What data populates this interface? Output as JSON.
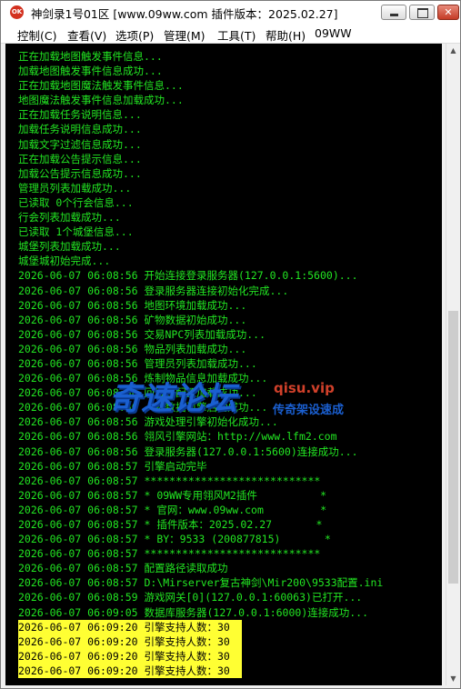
{
  "window": {
    "icon_text": "OK",
    "title": "神剑录1号01区 [www.09ww.com 插件版本：2025.02.27]",
    "controls": {
      "minimize": "",
      "maximize": "",
      "close": "✕"
    }
  },
  "menu": [
    "控制(C)",
    "查看(V)",
    "选项(P)",
    "管理(M)",
    "工具(T)",
    "帮助(H)",
    "09WW"
  ],
  "console": {
    "lines": [
      "正在加载地图触发事件信息...",
      "加载地图触发事件信息成功...",
      "正在加载地图魔法触发事件信息...",
      "地图魔法触发事件信息加载成功...",
      "正在加载任务说明信息...",
      "加载任务说明信息成功...",
      "加载文字过滤信息成功...",
      "正在加载公告提示信息...",
      "加载公告提示信息成功...",
      "管理员列表加载成功...",
      "已读取 0个行会信息...",
      "行会列表加载成功...",
      "已读取 1个城堡信息...",
      "城堡列表加载成功...",
      "城堡城初始完成...",
      "2026-06-07 06:08:56 开始连接登录服务器(127.0.0.1:5600)...",
      "2026-06-07 06:08:56 登录服务器连接初始化完成...",
      "2026-06-07 06:08:56 地图环境加载成功...",
      "2026-06-07 06:08:56 矿物数据初始成功...",
      "2026-06-07 06:08:56 交易NPC列表加载成功...",
      "2026-06-07 06:08:56 物品列表加载成功...",
      "2026-06-07 06:08:56 管理员列表加载成功...",
      "2026-06-07 06:08:56 炼制物品信息加载成功...",
      "2026-06-07 06:08:56 回城点配置加载成功...",
      "2026-06-07 06:08:56 人物数据引擎启动成功...",
      "2026-06-07 06:08:56 游戏处理引擎初始化成功...",
      "2026-06-07 06:08:56 翎风引擎网站：http://www.lfm2.com",
      "2026-06-07 06:08:56 登录服务器(127.0.0.1:5600)连接成功...",
      "2026-06-07 06:08:57 引擎启动完毕",
      "2026-06-07 06:08:57 ****************************",
      "2026-06-07 06:08:57 * 09WW专用翎风M2插件          *",
      "2026-06-07 06:08:57 * 官网：www.09ww.com         *",
      "2026-06-07 06:08:57 * 插件版本：2025.02.27       *",
      "2026-06-07 06:08:57 * BY：9533 (200877815)       *",
      "2026-06-07 06:08:57 ****************************",
      "2026-06-07 06:08:57 配置路径读取成功",
      "2026-06-07 06:08:57 D:\\Mirserver复古神剑\\Mir200\\9533配置.ini",
      "2026-06-07 06:08:59 游戏网关[0](127.0.0.1:60063)已打开...",
      "2026-06-07 06:09:05 数据库服务器(127.0.0.1:6000)连接成功..."
    ],
    "highlighted_lines": [
      "2026-06-07 06:09:20 引擎支持人数：30",
      "2026-06-07 06:09:20 引擎支持人数：30",
      "2026-06-07 06:09:20 引擎支持人数：30",
      "2026-06-07 06:09:20 引擎支持人数：30"
    ],
    "text_color": "#22e522",
    "highlight_color": "#ffff33",
    "background": "#000000"
  },
  "watermark": {
    "main": "奇速论坛",
    "url": "qisu.vip",
    "sub": "传奇架设速成"
  },
  "scrollbar": {
    "up_icon": "▲",
    "down_icon": "▼"
  }
}
